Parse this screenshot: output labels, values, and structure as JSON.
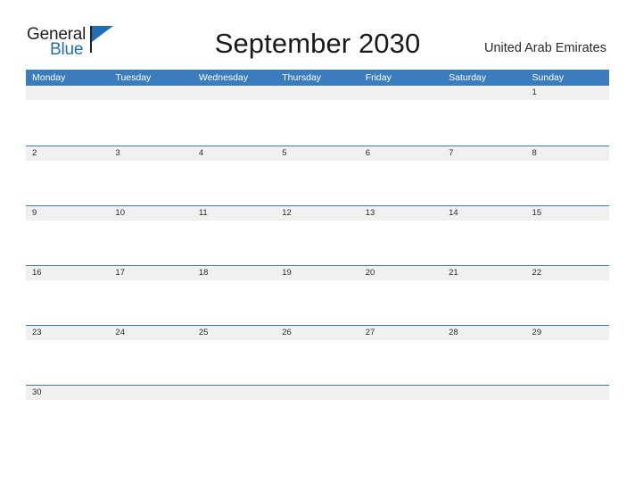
{
  "logo": {
    "word_top": "General",
    "word_bottom": "Blue",
    "flag_color": "#1f6fb5",
    "text_color": "#231f20"
  },
  "header": {
    "title": "September 2030",
    "country": "United Arab Emirates",
    "accent_color": "#3a7cbd",
    "band_color": "#f0f0f0"
  },
  "calendar": {
    "weekdays": [
      "Monday",
      "Tuesday",
      "Wednesday",
      "Thursday",
      "Friday",
      "Saturday",
      "Sunday"
    ],
    "weeks": [
      [
        "",
        "",
        "",
        "",
        "",
        "",
        "1"
      ],
      [
        "2",
        "3",
        "4",
        "5",
        "6",
        "7",
        "8"
      ],
      [
        "9",
        "10",
        "11",
        "12",
        "13",
        "14",
        "15"
      ],
      [
        "16",
        "17",
        "18",
        "19",
        "20",
        "21",
        "22"
      ],
      [
        "23",
        "24",
        "25",
        "26",
        "27",
        "28",
        "29"
      ],
      [
        "30",
        "",
        "",
        "",
        "",
        "",
        ""
      ]
    ]
  }
}
